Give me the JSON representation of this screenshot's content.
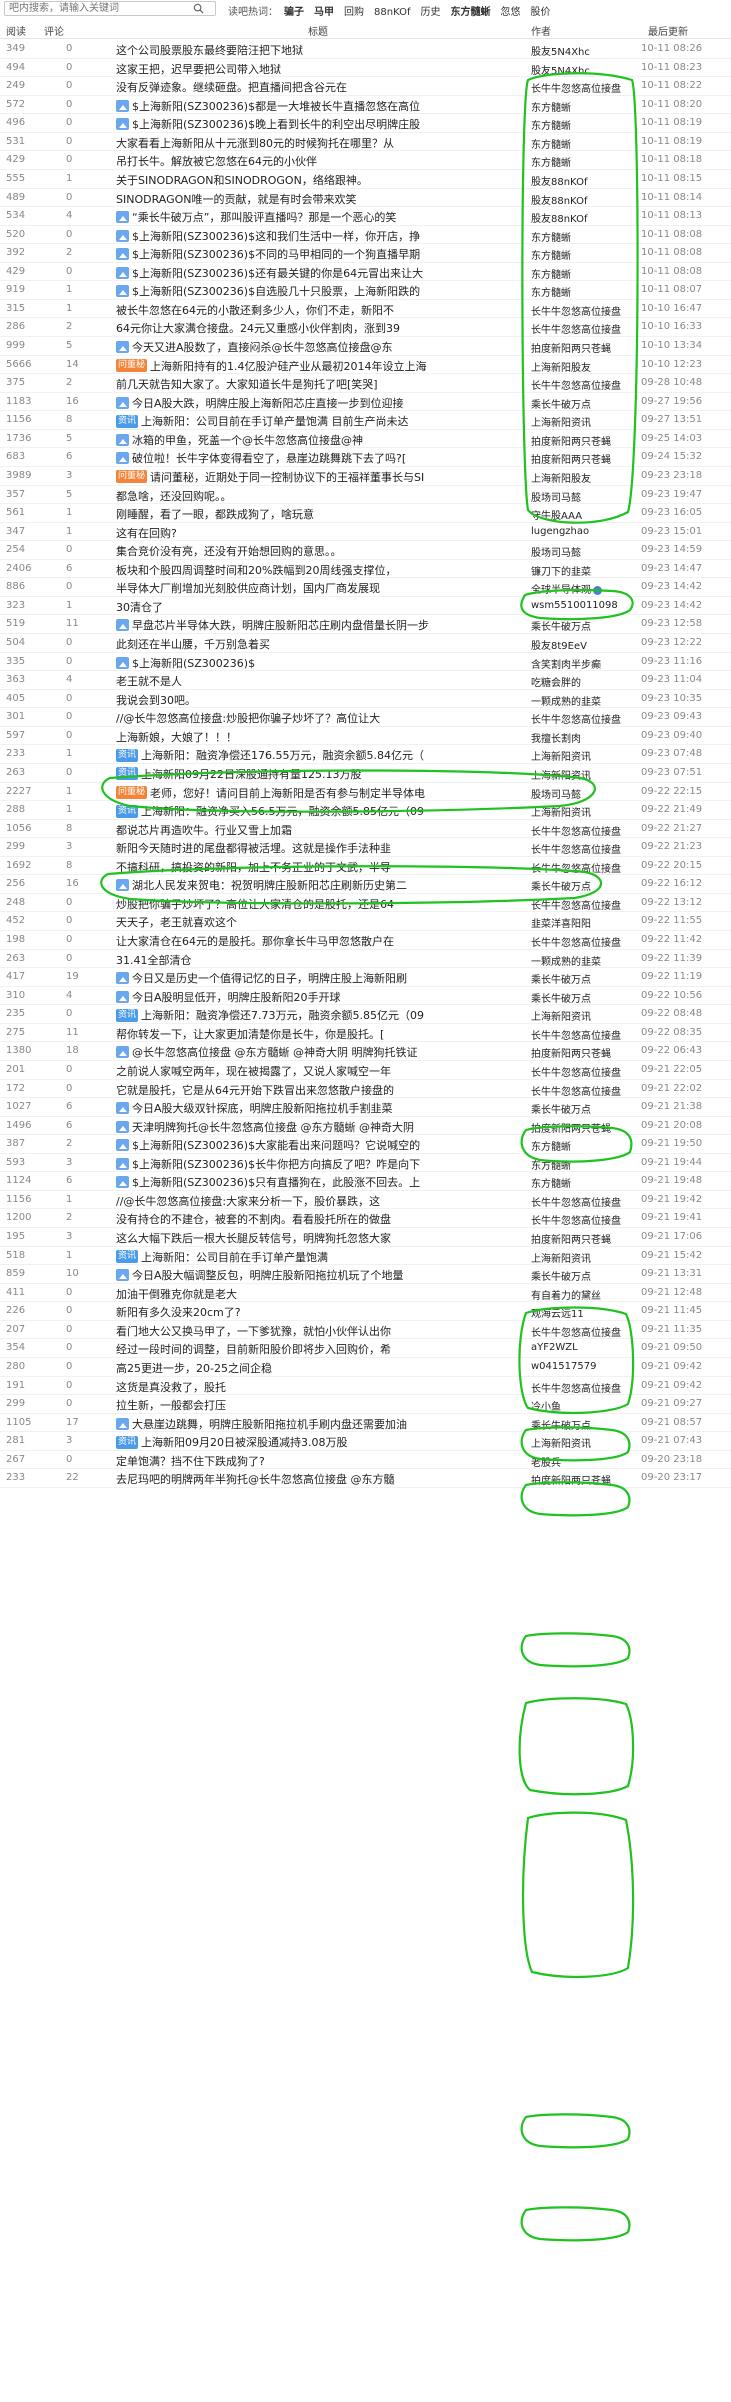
{
  "search": {
    "placeholder": "吧内搜索，请输入关键词"
  },
  "hotwords": {
    "label": "读吧热词：",
    "items": [
      "骗子",
      "马甲",
      "回购",
      "88nKOf",
      "历史",
      "东方髓蜥",
      "忽悠",
      "股价"
    ]
  },
  "header": {
    "read": "阅读",
    "comments": "评论",
    "title": "标题",
    "author": "作者",
    "time": "最后更新"
  },
  "rows": [
    {
      "read": "349",
      "comments": "0",
      "tag": "",
      "title": "这个公司股票股东最终要陪汪把下地狱",
      "author": "股友5N4Xhc",
      "time": "10-11 08:26"
    },
    {
      "read": "494",
      "comments": "0",
      "tag": "",
      "title": "这家王把，迟早要把公司带入地狱",
      "author": "股友5N4Xhc",
      "time": "10-11 08:23"
    },
    {
      "read": "249",
      "comments": "0",
      "tag": "",
      "title": "没有反弹迹象。继续砸盘。把直播间把含谷元在",
      "author": "长牛牛忽悠高位接盘",
      "time": "10-11 08:22"
    },
    {
      "read": "572",
      "comments": "0",
      "tag": "pic",
      "title": "$上海新阳(SZ300236)$都是一大堆被长牛直播忽悠在高位",
      "author": "东方髓蜥",
      "time": "10-11 08:20"
    },
    {
      "read": "496",
      "comments": "0",
      "tag": "pic",
      "title": "$上海新阳(SZ300236)$晚上看到长牛的利空出尽明牌庄股",
      "author": "东方髓蜥",
      "time": "10-11 08:19"
    },
    {
      "read": "531",
      "comments": "0",
      "tag": "",
      "title": "大家看看上海新阳从十元涨到80元的时候狗托在哪里？从",
      "author": "东方髓蜥",
      "time": "10-11 08:19"
    },
    {
      "read": "429",
      "comments": "0",
      "tag": "",
      "title": "吊打长牛。解放被它忽悠在64元的小伙伴",
      "author": "东方髓蜥",
      "time": "10-11 08:18"
    },
    {
      "read": "555",
      "comments": "1",
      "tag": "",
      "title": "关于SINODRAGON和SINODROGON，络络跟神。",
      "author": "股友88nKOf",
      "time": "10-11 08:15"
    },
    {
      "read": "489",
      "comments": "0",
      "tag": "",
      "title": "SINODRAGON唯一的贡献，就是有时会带来欢笑",
      "author": "股友88nKOf",
      "time": "10-11 08:14"
    },
    {
      "read": "534",
      "comments": "4",
      "tag": "pic",
      "title": "“乘长牛破万点”，那叫股评直播吗？那是一个恶心的笑",
      "author": "股友88nKOf",
      "time": "10-11 08:13"
    },
    {
      "read": "520",
      "comments": "0",
      "tag": "pic",
      "title": "$上海新阳(SZ300236)$这和我们生活中一样，你开店，挣",
      "author": "东方髓蜥",
      "time": "10-11 08:08"
    },
    {
      "read": "392",
      "comments": "2",
      "tag": "pic",
      "title": "$上海新阳(SZ300236)$不同的马甲相同的一个狗直播早期",
      "author": "东方髓蜥",
      "time": "10-11 08:08"
    },
    {
      "read": "429",
      "comments": "0",
      "tag": "pic",
      "title": "$上海新阳(SZ300236)$还有最关键的你是64元冒出来让大",
      "author": "东方髓蜥",
      "time": "10-11 08:08"
    },
    {
      "read": "919",
      "comments": "1",
      "tag": "pic",
      "title": "$上海新阳(SZ300236)$自选股几十只股票，上海新阳跌的",
      "author": "东方髓蜥",
      "time": "10-11 08:07"
    },
    {
      "read": "315",
      "comments": "1",
      "tag": "",
      "title": "被长牛忽悠在64元的小散还剩多少人，你们不走，新阳不",
      "author": "长牛牛忽悠高位接盘",
      "time": "10-10 16:47"
    },
    {
      "read": "286",
      "comments": "2",
      "tag": "",
      "title": "64元你让大家满仓接盘。24元又重感小伙伴割肉，涨到39",
      "author": "长牛牛忽悠高位接盘",
      "time": "10-10 16:33"
    },
    {
      "read": "999",
      "comments": "5",
      "tag": "pic",
      "title": "今天又进A股数了，直接闷杀@长牛忽悠高位接盘@东",
      "author": "拍度新阳两只苍蝇",
      "time": "10-10 13:34"
    },
    {
      "read": "5666",
      "comments": "14",
      "tag": "ask",
      "title": "上海新阳持有的1.4亿股沪硅产业从最初2014年设立上海",
      "author": "上海新阳股友",
      "time": "10-10 12:23"
    },
    {
      "read": "375",
      "comments": "2",
      "tag": "",
      "title": "前几天就告知大家了。大家知道长牛是狗托了吧[笑哭]",
      "author": "长牛牛忽悠高位接盘",
      "time": "09-28 10:48"
    },
    {
      "read": "1183",
      "comments": "16",
      "tag": "pic",
      "title": "今日A股大跌，明牌庄股上海新阳芯庄直接一步到位迎接",
      "author": "乘长牛破万点",
      "time": "09-27 19:56"
    },
    {
      "read": "1156",
      "comments": "8",
      "tag": "info",
      "title": "上海新阳：公司目前在手订单产量饱满 目前生产尚未达",
      "author": "上海新阳资讯",
      "time": "09-27 13:51"
    },
    {
      "read": "1736",
      "comments": "5",
      "tag": "pic",
      "title": "冰箱的甲鱼，死盖一个@长牛忽悠高位接盘@神",
      "author": "拍度新阳两只苍蝇",
      "time": "09-25 14:03"
    },
    {
      "read": "683",
      "comments": "6",
      "tag": "pic",
      "title": "破位啦！长牛字体变得看空了，悬崖边跳舞跳下去了吗?[",
      "author": "拍度新阳两只苍蝇",
      "time": "09-24 15:32"
    },
    {
      "read": "3989",
      "comments": "3",
      "tag": "ask",
      "title": "请问董秘，近期处于同一控制协议下的王福祥董事长与SI",
      "author": "上海新阳股友",
      "time": "09-23 23:18"
    },
    {
      "read": "357",
      "comments": "5",
      "tag": "",
      "title": "都急啥，还没回购呢。。",
      "author": "股场司马懿",
      "time": "09-23 19:47"
    },
    {
      "read": "561",
      "comments": "1",
      "tag": "",
      "title": "刚睡醒，看了一眼，都跌成狗了，啥玩意",
      "author": "守牛股AAA",
      "time": "09-23 16:05"
    },
    {
      "read": "347",
      "comments": "1",
      "tag": "",
      "title": "这有在回购?",
      "author": "lugengzhao",
      "time": "09-23 15:01"
    },
    {
      "read": "254",
      "comments": "0",
      "tag": "",
      "title": "集合竞价没有亮，还没有开始想回购的意思。。",
      "author": "股场司马懿",
      "time": "09-23 14:59"
    },
    {
      "read": "2406",
      "comments": "6",
      "tag": "",
      "title": "板块和个股四周调整时间和20%跌幅到20周线强支撑位，",
      "author": "镰刀下的韭菜",
      "time": "09-23 14:47"
    },
    {
      "read": "886",
      "comments": "0",
      "tag": "",
      "title": "半导体大厂削增加光刻胶供应商计划，国内厂商发展现",
      "author": "全球半导体观",
      "time": "09-23 14:42",
      "badge": true
    },
    {
      "read": "323",
      "comments": "1",
      "tag": "",
      "title": "30清仓了",
      "author": "wsm5510011098",
      "time": "09-23 14:42"
    },
    {
      "read": "519",
      "comments": "11",
      "tag": "pic",
      "title": "早盘芯片半导体大跌，明牌庄股新阳芯庄刷内盘借量长阴一步",
      "author": "乘长牛破万点",
      "time": "09-23 12:58"
    },
    {
      "read": "504",
      "comments": "0",
      "tag": "",
      "title": "此刻还在半山腰，千万别急着买",
      "author": "股友8t9EeV",
      "time": "09-23 12:22"
    },
    {
      "read": "335",
      "comments": "0",
      "tag": "pic",
      "title": "$上海新阳(SZ300236)$",
      "author": "含笑割肉半步癫",
      "time": "09-23 11:16"
    },
    {
      "read": "363",
      "comments": "4",
      "tag": "",
      "title": "老王就不是人",
      "author": "吃糖会胖的",
      "time": "09-23 11:04"
    },
    {
      "read": "405",
      "comments": "0",
      "tag": "",
      "title": "我说会到30吧。",
      "author": "一颗成熟的韭菜",
      "time": "09-23 10:35"
    },
    {
      "read": "301",
      "comments": "0",
      "tag": "",
      "title": "//@长牛忽悠高位接盘:炒股把你骗子炒坏了？高位让大",
      "author": "长牛牛忽悠高位接盘",
      "time": "09-23 09:43"
    },
    {
      "read": "597",
      "comments": "0",
      "tag": "",
      "title": "上海新娘，大娘了！！！",
      "author": "我擅长割肉",
      "time": "09-23 09:40"
    },
    {
      "read": "233",
      "comments": "1",
      "tag": "info",
      "title": "上海新阳：融资净偿还176.55万元，融资余额5.84亿元（",
      "author": "上海新阳资讯",
      "time": "09-23 07:48"
    },
    {
      "read": "263",
      "comments": "0",
      "tag": "info",
      "title": "上海新阳09月22日深股通持有量125.13万股",
      "author": "上海新阳资讯",
      "time": "09-23 07:51"
    },
    {
      "read": "2227",
      "comments": "1",
      "tag": "ask",
      "title": "老师，您好！请问目前上海新阳是否有参与制定半导体电",
      "author": "股场司马懿",
      "time": "09-22 22:15"
    },
    {
      "read": "288",
      "comments": "1",
      "tag": "info",
      "title": "上海新阳：融资净买入56.5万元，融资余额5.85亿元（09",
      "author": "上海新阳资讯",
      "time": "09-22 21:49"
    },
    {
      "read": "1056",
      "comments": "8",
      "tag": "",
      "title": "都说芯片再造吹牛。行业又雪上加霜",
      "author": "长牛牛忽悠高位接盘",
      "time": "09-22 21:27"
    },
    {
      "read": "299",
      "comments": "3",
      "tag": "",
      "title": "新阳今天随时进的尾盘都得被活埋。这就是操作手法种韭",
      "author": "长牛牛忽悠高位接盘",
      "time": "09-22 21:23"
    },
    {
      "read": "1692",
      "comments": "8",
      "tag": "",
      "title": "不搞科研，搞投资的新阳，加上不务正业的丁文武，半导",
      "author": "长牛牛忽悠高位接盘",
      "time": "09-22 20:15"
    },
    {
      "read": "256",
      "comments": "16",
      "tag": "pic",
      "title": "湖北人民发来贺电：祝贺明牌庄股新阳芯庄刷新历史第二",
      "author": "乘长牛破万点",
      "time": "09-22 16:12"
    },
    {
      "read": "248",
      "comments": "0",
      "tag": "",
      "title": "炒股把你骗子炒坏了？高位让大家清仓的是股托，还是64",
      "author": "长牛牛忽悠高位接盘",
      "time": "09-22 13:12"
    },
    {
      "read": "452",
      "comments": "0",
      "tag": "",
      "title": "天天子，老王就喜欢这个",
      "author": "韭菜洋喜阳阳",
      "time": "09-22 11:55"
    },
    {
      "read": "198",
      "comments": "0",
      "tag": "",
      "title": "让大家清仓在64元的是股托。那你拿长牛马甲忽悠散户在",
      "author": "长牛牛忽悠高位接盘",
      "time": "09-22 11:42"
    },
    {
      "read": "263",
      "comments": "0",
      "tag": "",
      "title": "31.41全部清仓",
      "author": "一颗成熟的韭菜",
      "time": "09-22 11:39"
    },
    {
      "read": "417",
      "comments": "19",
      "tag": "pic",
      "title": "今日又是历史一个值得记忆的日子，明牌庄股上海新阳刷",
      "author": "乘长牛破万点",
      "time": "09-22 11:19"
    },
    {
      "read": "310",
      "comments": "4",
      "tag": "pic",
      "title": "今日A股明显低开，明牌庄股新阳20手开球",
      "author": "乘长牛破万点",
      "time": "09-22 10:56"
    },
    {
      "read": "235",
      "comments": "0",
      "tag": "info",
      "title": "上海新阳：融资净偿还7.73万元，融资余额5.85亿元（09",
      "author": "上海新阳资讯",
      "time": "09-22 08:48"
    },
    {
      "read": "275",
      "comments": "11",
      "tag": "",
      "title": "帮你转发一下，让大家更加清楚你是长牛，你是股托。[",
      "author": "长牛牛忽悠高位接盘",
      "time": "09-22 08:35"
    },
    {
      "read": "1380",
      "comments": "18",
      "tag": "pic",
      "title": "@长牛忽悠高位接盘 @东方髓蜥 @神奇大阴 明牌狗托铁证",
      "author": "拍度新阳两只苍蝇",
      "time": "09-22 06:43"
    },
    {
      "read": "201",
      "comments": "0",
      "tag": "",
      "title": "之前说人家喊空两年，现在被揭露了，又说人家喊空一年",
      "author": "长牛牛忽悠高位接盘",
      "time": "09-21 22:05"
    },
    {
      "read": "172",
      "comments": "0",
      "tag": "",
      "title": "它就是股托，它是从64元开始下跌冒出来忽悠散户接盘的",
      "author": "长牛牛忽悠高位接盘",
      "time": "09-21 22:02"
    },
    {
      "read": "1027",
      "comments": "6",
      "tag": "pic",
      "title": "今日A股大级双针探底，明牌庄股新阳拖拉机手割韭菜",
      "author": "乘长牛破万点",
      "time": "09-21 21:38"
    },
    {
      "read": "1496",
      "comments": "6",
      "tag": "pic",
      "title": "天津明牌狗托@长牛忽悠高位接盘 @东方髓蜥 @神奇大阴",
      "author": "拍度新阳两只苍蝇",
      "time": "09-21 20:08"
    },
    {
      "read": "387",
      "comments": "2",
      "tag": "pic",
      "title": "$上海新阳(SZ300236)$大家能看出来问题吗？它说喊空的",
      "author": "东方髓蜥",
      "time": "09-21 19:50"
    },
    {
      "read": "593",
      "comments": "3",
      "tag": "pic",
      "title": "$上海新阳(SZ300236)$长牛你把方向搞反了吧？咋是向下",
      "author": "东方髓蜥",
      "time": "09-21 19:44"
    },
    {
      "read": "1124",
      "comments": "6",
      "tag": "pic",
      "title": "$上海新阳(SZ300236)$只有直播狗在，此股涨不回去。上",
      "author": "东方髓蜥",
      "time": "09-21 19:48"
    },
    {
      "read": "1156",
      "comments": "1",
      "tag": "",
      "title": "//@长牛忽悠高位接盘:大家来分析一下，股价暴跌，这",
      "author": "长牛牛忽悠高位接盘",
      "time": "09-21 19:42"
    },
    {
      "read": "1200",
      "comments": "2",
      "tag": "",
      "title": "没有持仓的不建仓，被套的不割肉。看看股托所在的做盘",
      "author": "长牛牛忽悠高位接盘",
      "time": "09-21 19:41"
    },
    {
      "read": "195",
      "comments": "3",
      "tag": "",
      "title": "这么大幅下跌后一根大长腿反转信号，明牌狗托忽悠大家",
      "author": "拍度新阳两只苍蝇",
      "time": "09-21 17:06"
    },
    {
      "read": "518",
      "comments": "1",
      "tag": "info",
      "title": "上海新阳：公司目前在手订单产量饱满",
      "author": "上海新阳资讯",
      "time": "09-21 15:42"
    },
    {
      "read": "859",
      "comments": "10",
      "tag": "pic",
      "title": "今日A股大幅调整反包，明牌庄股新阳拖拉机玩了个地量",
      "author": "乘长牛破万点",
      "time": "09-21 13:31"
    },
    {
      "read": "411",
      "comments": "0",
      "tag": "",
      "title": "加油干倒雅克你就是老大",
      "author": "有自着力的黛丝",
      "time": "09-21 12:48"
    },
    {
      "read": "226",
      "comments": "0",
      "tag": "",
      "title": "新阳有多久没来20cm了?",
      "author": "观海云远11",
      "time": "09-21 11:45"
    },
    {
      "read": "207",
      "comments": "0",
      "tag": "",
      "title": "看门地大公又换马甲了，一下爹犹豫，就怕小伙伴认出你",
      "author": "长牛牛忽悠高位接盘",
      "time": "09-21 11:35"
    },
    {
      "read": "354",
      "comments": "0",
      "tag": "",
      "title": "经过一段时间的调整，目前新阳股价即将步入回购价，希",
      "author": "aYF2WZL",
      "time": "09-21 09:50"
    },
    {
      "read": "280",
      "comments": "0",
      "tag": "",
      "title": "高25更进一步，20-25之间企稳",
      "author": "w041517579",
      "time": "09-21 09:42"
    },
    {
      "read": "191",
      "comments": "0",
      "tag": "",
      "title": "这货是真没救了，股托",
      "author": "长牛牛忽悠高位接盘",
      "time": "09-21 09:42"
    },
    {
      "read": "299",
      "comments": "0",
      "tag": "",
      "title": "拉生新，一般都会打压",
      "author": "冷小鱼",
      "time": "09-21 09:27"
    },
    {
      "read": "1105",
      "comments": "17",
      "tag": "pic",
      "title": "大悬崖边跳舞，明牌庄股新阳拖拉机手刷内盘还需要加油",
      "author": "乘长牛破万点",
      "time": "09-21 08:57"
    },
    {
      "read": "281",
      "comments": "3",
      "tag": "info",
      "title": "上海新阳09月20日被深股通减持3.08万股",
      "author": "上海新阳资讯",
      "time": "09-21 07:43"
    },
    {
      "read": "267",
      "comments": "0",
      "tag": "",
      "title": "定单饱满？挡不住下跌成狗了?",
      "author": "老股兵",
      "time": "09-20 23:18"
    },
    {
      "read": "233",
      "comments": "22",
      "tag": "",
      "title": "去尼玛吧的明牌两年半狗托@长牛忽悠高位接盘 @东方髓",
      "author": "拍度新阳两只苍蝇",
      "time": "09-20 23:17"
    }
  ],
  "tag_labels": {
    "ask": "问董秘",
    "info": "资讯"
  },
  "colors": {
    "annotation": "#1fc21f",
    "tag_ask": "#f3853b",
    "tag_info": "#4c9be8"
  }
}
